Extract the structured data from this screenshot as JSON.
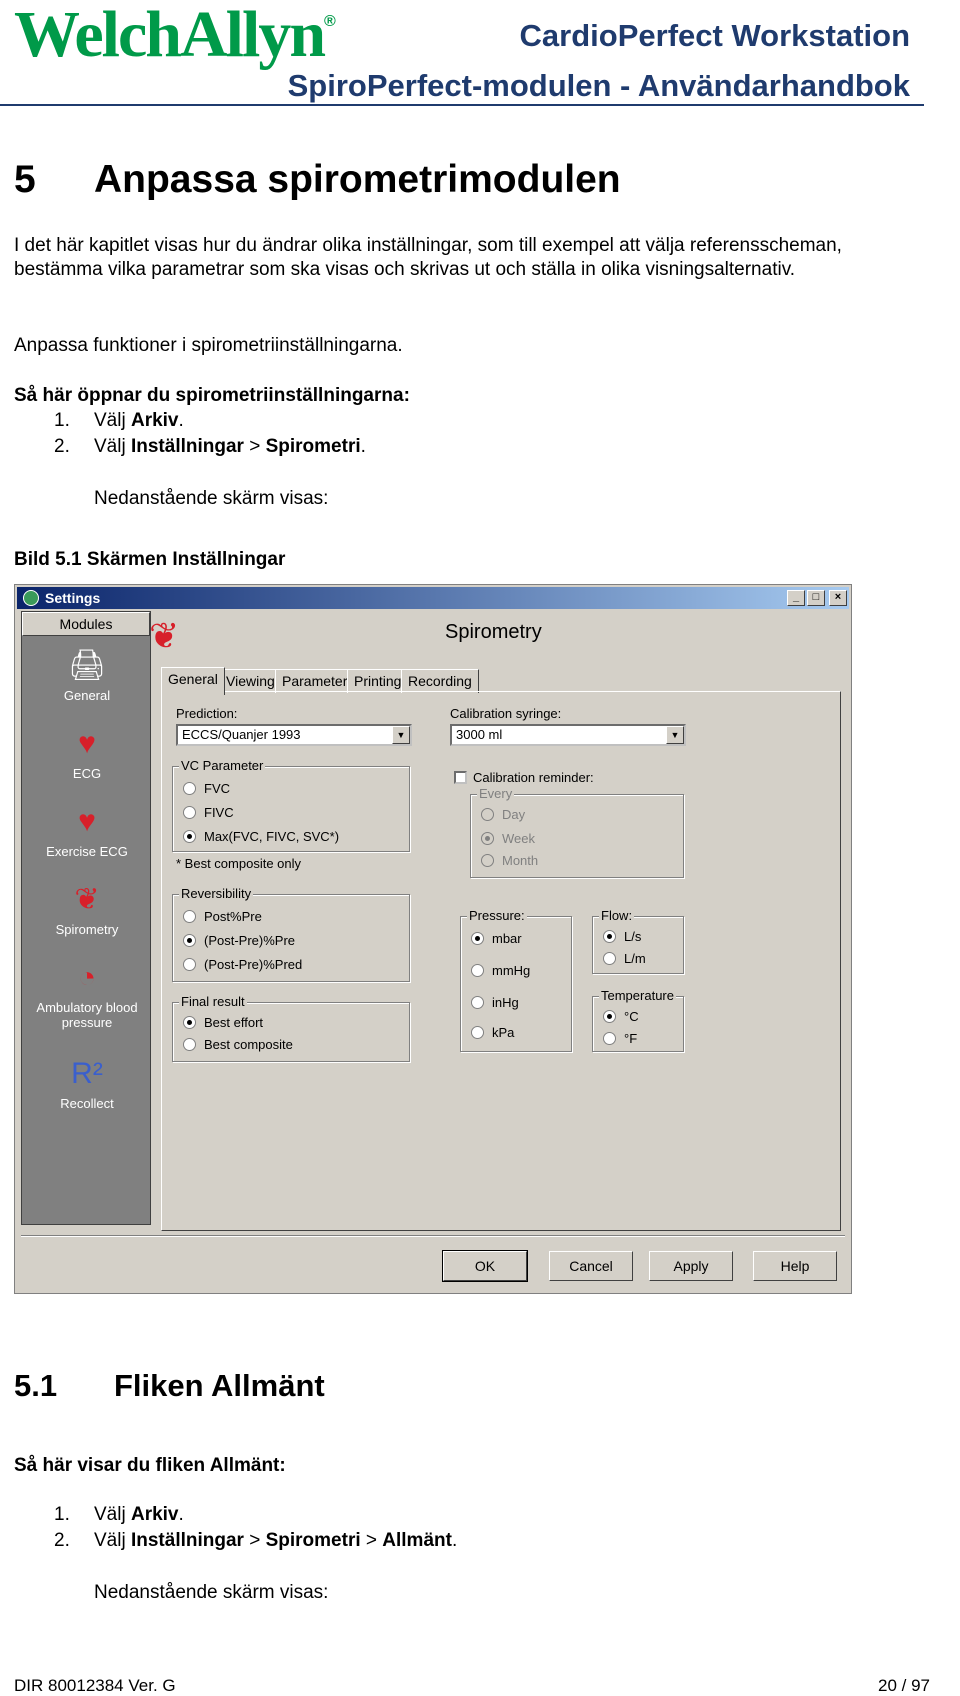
{
  "header": {
    "logo": "WelchAllyn",
    "logo_mark": "®",
    "product": "CardioPerfect Workstation",
    "manual": "SpiroPerfect-modulen - Användarhandbok"
  },
  "chapter": {
    "number": "5",
    "title": "Anpassa spirometrimodulen",
    "intro": "I det här kapitlet visas hur du ändrar olika inställningar, som till exempel att välja referensscheman, bestämma vilka parametrar som ska visas och skrivas ut och ställa in olika visningsalternativ.",
    "intro2": "Anpassa funktioner i spirometriinställningarna.",
    "howto_heading": "Så här öppnar du spirometriinställningarna:",
    "steps": [
      {
        "n": "1.",
        "pre": "Välj ",
        "b1": "Arkiv",
        "post": "."
      },
      {
        "n": "2.",
        "pre": "Välj ",
        "b1": "Inställningar",
        "mid": " > ",
        "b2": "Spirometri",
        "post": "."
      }
    ],
    "screen_note": "Nedanstående skärm visas:",
    "figure_caption": "Bild 5.1 Skärmen Inställningar"
  },
  "window": {
    "title": "Settings",
    "controls": [
      "_",
      "□",
      "×"
    ],
    "modules_label": "Modules",
    "modules": [
      {
        "label": "General",
        "icon": "printer-icon"
      },
      {
        "label": "ECG",
        "icon": "ecg-heart-icon"
      },
      {
        "label": "Exercise ECG",
        "icon": "running-heart-icon"
      },
      {
        "label": "Spirometry",
        "icon": "lungs-icon"
      },
      {
        "label": "Ambulatory blood pressure",
        "icon": "blood-pressure-icon"
      },
      {
        "label": "Recollect",
        "icon": "recollect-icon"
      }
    ],
    "heading": "Spirometry",
    "tabs": [
      "General",
      "Viewing",
      "Parameters",
      "Printing",
      "Recording"
    ],
    "prediction_label": "Prediction:",
    "prediction_value": "ECCS/Quanjer 1993",
    "calibration_label": "Calibration syringe:",
    "calibration_value": "3000 ml",
    "vc_label": "VC Parameter",
    "vc_options": [
      "FVC",
      "FIVC",
      "Max(FVC, FIVC, SVC*)"
    ],
    "vc_footnote": "* Best composite only",
    "cal_reminder": "Calibration reminder:",
    "every_label": "Every",
    "every_options": [
      "Day",
      "Week",
      "Month"
    ],
    "reversibility_label": "Reversibility",
    "reversibility_options": [
      "Post%Pre",
      "(Post-Pre)%Pre",
      "(Post-Pre)%Pred"
    ],
    "pressure_label": "Pressure:",
    "pressure_options": [
      "mbar",
      "mmHg",
      "inHg",
      "kPa"
    ],
    "flow_label": "Flow:",
    "flow_options": [
      "L/s",
      "L/m"
    ],
    "temperature_label": "Temperature",
    "temperature_options": [
      "°C",
      "°F"
    ],
    "final_label": "Final result",
    "final_options": [
      "Best effort",
      "Best composite"
    ],
    "buttons": [
      "OK",
      "Cancel",
      "Apply",
      "Help"
    ]
  },
  "section": {
    "number": "5.1",
    "title": "Fliken Allmänt",
    "howto_heading": "Så här visar du fliken Allmänt:",
    "steps": [
      {
        "n": "1.",
        "pre": "Välj ",
        "b1": "Arkiv",
        "post": "."
      },
      {
        "n": "2.",
        "pre": "Välj ",
        "b1": "Inställningar",
        "mid": " > ",
        "b2": "Spirometri",
        "mid2": " > ",
        "b3": "Allmänt",
        "post": "."
      }
    ],
    "screen_note": "Nedanstående skärm visas:"
  },
  "footer": {
    "doc_id": "DIR 80012384 Ver. G",
    "page": "20 / 97"
  }
}
